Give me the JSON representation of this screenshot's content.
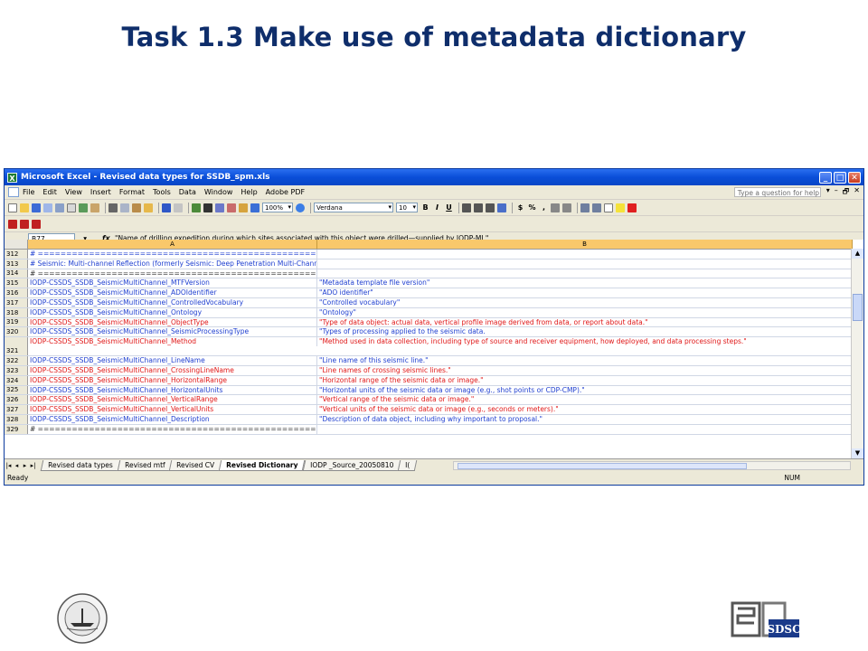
{
  "slide": {
    "title": "Task 1.3  Make use of metadata dictionary"
  },
  "window": {
    "title": "Microsoft Excel - Revised data types for SSDB_spm.xls",
    "excel_icon_letter": "X",
    "min": "_",
    "max": "□",
    "close": "✕"
  },
  "menu": {
    "items": [
      "File",
      "Edit",
      "View",
      "Insert",
      "Format",
      "Tools",
      "Data",
      "Window",
      "Help",
      "Adobe PDF"
    ],
    "help_placeholder": "Type a question for help",
    "mdi_buttons": [
      "▾",
      "–",
      "🗗",
      "✕"
    ]
  },
  "toolbar": {
    "zoom": "100%",
    "font": "Verdana",
    "font_size": "10",
    "format_letters": [
      "B",
      "I",
      "U"
    ],
    "number_symbols": [
      "$",
      "%",
      ","
    ]
  },
  "formula_bar": {
    "cell_ref": "B77",
    "fx": "fx",
    "content": "\"Name of drilling expedition during which sites associated with this object were drilled—supplied by IODP-MI.\""
  },
  "grid": {
    "col_a": "A",
    "col_b": "B",
    "rows": [
      {
        "num": "312",
        "a": "# ==============================================================================================================",
        "b": "",
        "color": "blue"
      },
      {
        "num": "313",
        "a": "# Seismic: Multi-channel Reflection (formerly Seismic: Deep Penetration Multi-Channel)",
        "b": "",
        "color": "blue"
      },
      {
        "num": "314",
        "a": "# ==============================================================================================================",
        "b": "",
        "color": "black"
      },
      {
        "num": "315",
        "a": "IODP-CSSDS_SSDB_SeismicMultiChannel_MTFVersion",
        "b": "\"Metadata template file version\"",
        "color": "blue"
      },
      {
        "num": "316",
        "a": "IODP-CSSDS_SSDB_SeismicMultiChannel_ADOIdentifier",
        "b": "\"ADO identifier\"",
        "color": "blue"
      },
      {
        "num": "317",
        "a": "IODP-CSSDS_SSDB_SeismicMultiChannel_ControlledVocabulary",
        "b": "\"Controlled vocabulary\"",
        "color": "blue"
      },
      {
        "num": "318",
        "a": "IODP-CSSDS_SSDB_SeismicMultiChannel_Ontology",
        "b": "\"Ontology\"",
        "color": "blue"
      },
      {
        "num": "319",
        "a": "IODP-CSSDS_SSDB_SeismicMultiChannel_ObjectType",
        "b": "\"Type of data object: actual data, vertical profile image derived from data, or report about data.\"",
        "color": "red"
      },
      {
        "num": "320",
        "a": "IODP-CSSDS_SSDB_SeismicMultiChannel_SeismicProcessingType",
        "b": "\"Types of processing applied to the seismic data.",
        "color": "blue"
      },
      {
        "num": "321",
        "a": "IODP-CSSDS_SSDB_SeismicMultiChannel_Method",
        "b": "\"Method used in data collection, including type of source and receiver equipment, how deployed, and data processing steps.\"",
        "color": "red",
        "tall": true
      },
      {
        "num": "322",
        "a": "IODP-CSSDS_SSDB_SeismicMultiChannel_LineName",
        "b": "\"Line name of this seismic line.\"",
        "color": "blue"
      },
      {
        "num": "323",
        "a": "IODP-CSSDS_SSDB_SeismicMultiChannel_CrossingLineName",
        "b": "\"Line names of crossing seismic lines.\"",
        "color": "red"
      },
      {
        "num": "324",
        "a": "IODP-CSSDS_SSDB_SeismicMultiChannel_HorizontalRange",
        "b": "\"Horizontal range of the seismic data or image.\"",
        "color": "red"
      },
      {
        "num": "325",
        "a": "IODP-CSSDS_SSDB_SeismicMultiChannel_HorizontalUnits",
        "b": "\"Horizontal units of the seismic data or image (e.g., shot points or CDP-CMP).\"",
        "color": "blue"
      },
      {
        "num": "326",
        "a": "IODP-CSSDS_SSDB_SeismicMultiChannel_VerticalRange",
        "b": "\"Vertical range of the seismic data or image.\"",
        "color": "red"
      },
      {
        "num": "327",
        "a": "IODP-CSSDS_SSDB_SeismicMultiChannel_VerticalUnits",
        "b": "\"Vertical units of the seismic data or image (e.g., seconds or meters).\"",
        "color": "red"
      },
      {
        "num": "328",
        "a": "IODP-CSSDS_SSDB_SeismicMultiChannel_Description",
        "b": "\"Description of data object, including why important to proposal.\"",
        "color": "blue"
      },
      {
        "num": "329",
        "a": "# ==============================================================================================================",
        "b": "",
        "color": "black"
      }
    ]
  },
  "tabs": {
    "nav": [
      "|◂",
      "◂",
      "▸",
      "▸|"
    ],
    "items": [
      {
        "label": "Revised data types",
        "active": false
      },
      {
        "label": "Revised mtf",
        "active": false
      },
      {
        "label": "Revised CV",
        "active": false
      },
      {
        "label": "Revised Dictionary",
        "active": true
      },
      {
        "label": "IODP _Source_20050810",
        "active": false
      },
      {
        "label": "I(",
        "active": false
      }
    ]
  },
  "status": {
    "left": "Ready",
    "right": "NUM"
  },
  "colors": {
    "title": "#0f2e6b",
    "link_blue": "#1f3fd0",
    "red": "#e01818",
    "header_active": "#f9c86b"
  }
}
